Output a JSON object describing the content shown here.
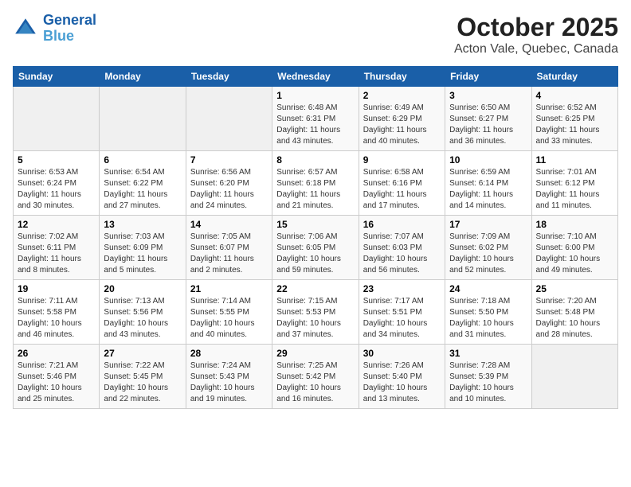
{
  "header": {
    "logo_line1": "General",
    "logo_line2": "Blue",
    "title": "October 2025",
    "subtitle": "Acton Vale, Quebec, Canada"
  },
  "weekdays": [
    "Sunday",
    "Monday",
    "Tuesday",
    "Wednesday",
    "Thursday",
    "Friday",
    "Saturday"
  ],
  "weeks": [
    [
      {
        "day": "",
        "info": ""
      },
      {
        "day": "",
        "info": ""
      },
      {
        "day": "",
        "info": ""
      },
      {
        "day": "1",
        "info": "Sunrise: 6:48 AM\nSunset: 6:31 PM\nDaylight: 11 hours\nand 43 minutes."
      },
      {
        "day": "2",
        "info": "Sunrise: 6:49 AM\nSunset: 6:29 PM\nDaylight: 11 hours\nand 40 minutes."
      },
      {
        "day": "3",
        "info": "Sunrise: 6:50 AM\nSunset: 6:27 PM\nDaylight: 11 hours\nand 36 minutes."
      },
      {
        "day": "4",
        "info": "Sunrise: 6:52 AM\nSunset: 6:25 PM\nDaylight: 11 hours\nand 33 minutes."
      }
    ],
    [
      {
        "day": "5",
        "info": "Sunrise: 6:53 AM\nSunset: 6:24 PM\nDaylight: 11 hours\nand 30 minutes."
      },
      {
        "day": "6",
        "info": "Sunrise: 6:54 AM\nSunset: 6:22 PM\nDaylight: 11 hours\nand 27 minutes."
      },
      {
        "day": "7",
        "info": "Sunrise: 6:56 AM\nSunset: 6:20 PM\nDaylight: 11 hours\nand 24 minutes."
      },
      {
        "day": "8",
        "info": "Sunrise: 6:57 AM\nSunset: 6:18 PM\nDaylight: 11 hours\nand 21 minutes."
      },
      {
        "day": "9",
        "info": "Sunrise: 6:58 AM\nSunset: 6:16 PM\nDaylight: 11 hours\nand 17 minutes."
      },
      {
        "day": "10",
        "info": "Sunrise: 6:59 AM\nSunset: 6:14 PM\nDaylight: 11 hours\nand 14 minutes."
      },
      {
        "day": "11",
        "info": "Sunrise: 7:01 AM\nSunset: 6:12 PM\nDaylight: 11 hours\nand 11 minutes."
      }
    ],
    [
      {
        "day": "12",
        "info": "Sunrise: 7:02 AM\nSunset: 6:11 PM\nDaylight: 11 hours\nand 8 minutes."
      },
      {
        "day": "13",
        "info": "Sunrise: 7:03 AM\nSunset: 6:09 PM\nDaylight: 11 hours\nand 5 minutes."
      },
      {
        "day": "14",
        "info": "Sunrise: 7:05 AM\nSunset: 6:07 PM\nDaylight: 11 hours\nand 2 minutes."
      },
      {
        "day": "15",
        "info": "Sunrise: 7:06 AM\nSunset: 6:05 PM\nDaylight: 10 hours\nand 59 minutes."
      },
      {
        "day": "16",
        "info": "Sunrise: 7:07 AM\nSunset: 6:03 PM\nDaylight: 10 hours\nand 56 minutes."
      },
      {
        "day": "17",
        "info": "Sunrise: 7:09 AM\nSunset: 6:02 PM\nDaylight: 10 hours\nand 52 minutes."
      },
      {
        "day": "18",
        "info": "Sunrise: 7:10 AM\nSunset: 6:00 PM\nDaylight: 10 hours\nand 49 minutes."
      }
    ],
    [
      {
        "day": "19",
        "info": "Sunrise: 7:11 AM\nSunset: 5:58 PM\nDaylight: 10 hours\nand 46 minutes."
      },
      {
        "day": "20",
        "info": "Sunrise: 7:13 AM\nSunset: 5:56 PM\nDaylight: 10 hours\nand 43 minutes."
      },
      {
        "day": "21",
        "info": "Sunrise: 7:14 AM\nSunset: 5:55 PM\nDaylight: 10 hours\nand 40 minutes."
      },
      {
        "day": "22",
        "info": "Sunrise: 7:15 AM\nSunset: 5:53 PM\nDaylight: 10 hours\nand 37 minutes."
      },
      {
        "day": "23",
        "info": "Sunrise: 7:17 AM\nSunset: 5:51 PM\nDaylight: 10 hours\nand 34 minutes."
      },
      {
        "day": "24",
        "info": "Sunrise: 7:18 AM\nSunset: 5:50 PM\nDaylight: 10 hours\nand 31 minutes."
      },
      {
        "day": "25",
        "info": "Sunrise: 7:20 AM\nSunset: 5:48 PM\nDaylight: 10 hours\nand 28 minutes."
      }
    ],
    [
      {
        "day": "26",
        "info": "Sunrise: 7:21 AM\nSunset: 5:46 PM\nDaylight: 10 hours\nand 25 minutes."
      },
      {
        "day": "27",
        "info": "Sunrise: 7:22 AM\nSunset: 5:45 PM\nDaylight: 10 hours\nand 22 minutes."
      },
      {
        "day": "28",
        "info": "Sunrise: 7:24 AM\nSunset: 5:43 PM\nDaylight: 10 hours\nand 19 minutes."
      },
      {
        "day": "29",
        "info": "Sunrise: 7:25 AM\nSunset: 5:42 PM\nDaylight: 10 hours\nand 16 minutes."
      },
      {
        "day": "30",
        "info": "Sunrise: 7:26 AM\nSunset: 5:40 PM\nDaylight: 10 hours\nand 13 minutes."
      },
      {
        "day": "31",
        "info": "Sunrise: 7:28 AM\nSunset: 5:39 PM\nDaylight: 10 hours\nand 10 minutes."
      },
      {
        "day": "",
        "info": ""
      }
    ]
  ]
}
